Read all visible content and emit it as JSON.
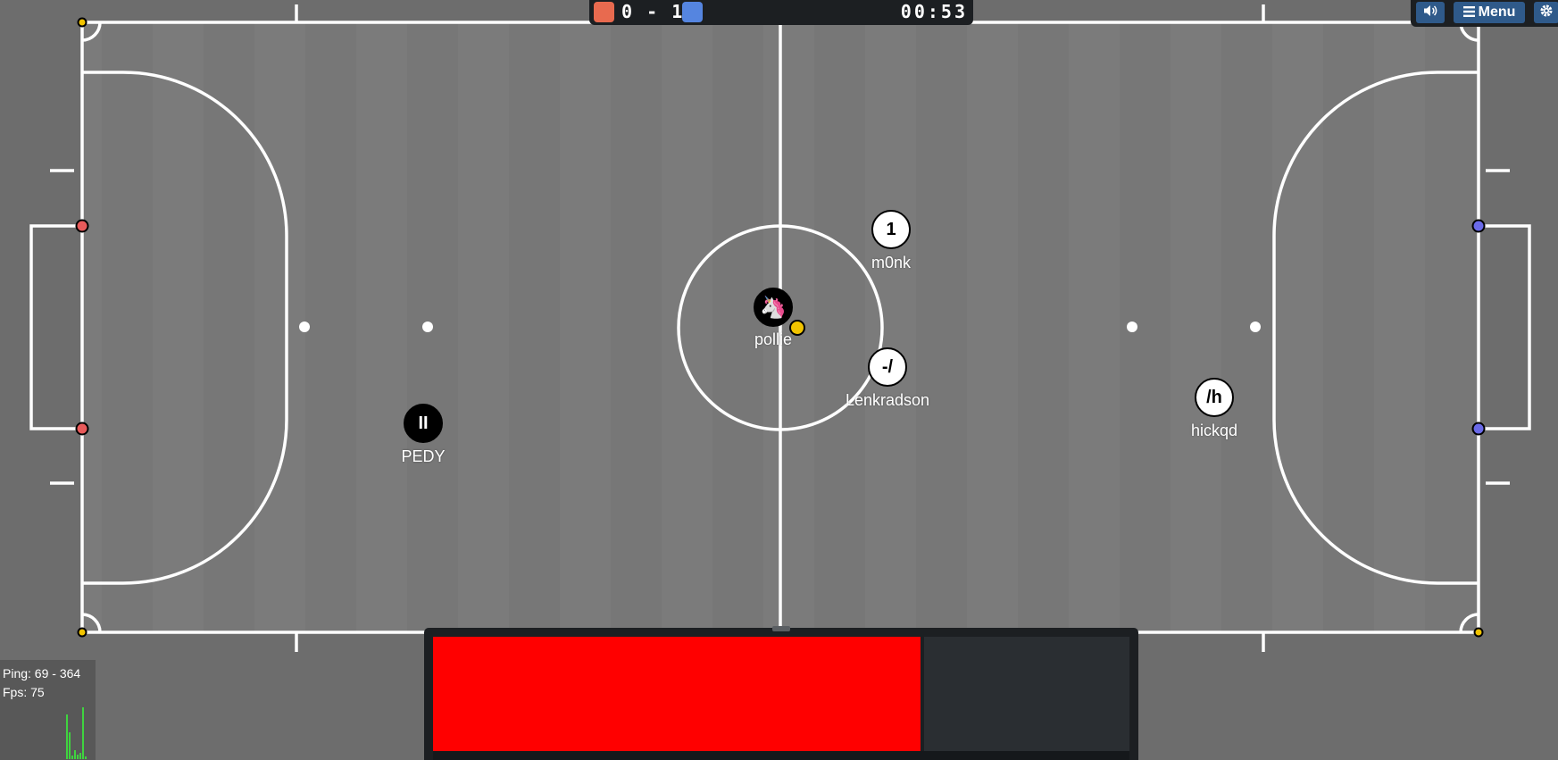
{
  "scoreboard": {
    "red_score": "0",
    "separator": "-",
    "blue_score": "1",
    "timer": "00:53",
    "red_color": "#e86a4f",
    "blue_color": "#5585e0"
  },
  "toolbar": {
    "sound_icon": "speaker-icon",
    "menu_label": "Menu",
    "menu_icon": "hamburger-icon",
    "settings_icon": "gear-icon"
  },
  "players": [
    {
      "name": "PEDY",
      "avatar": "II",
      "team": "red"
    },
    {
      "name": "pollie",
      "avatar": "🦄",
      "team": "red"
    },
    {
      "name": "m0nk",
      "avatar": "1",
      "team": "blue"
    },
    {
      "name": "Lenkradson",
      "avatar": "-/",
      "team": "blue"
    },
    {
      "name": "hickqd",
      "avatar": "/h",
      "team": "blue"
    }
  ],
  "stats": {
    "ping_label": "Ping: 69 - 364",
    "fps_label": "Fps: 75",
    "fps_graph_color": "#3fd43f"
  },
  "colors": {
    "field": "#7a7a7a",
    "lines": "#ffffff",
    "red_post": "#e85a5a",
    "blue_post": "#6a6ae8",
    "ball": "#f2c400",
    "chat_highlight": "#ff0000"
  }
}
